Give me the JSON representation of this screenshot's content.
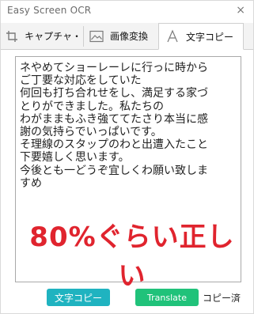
{
  "window": {
    "title": "Easy Screen OCR",
    "close_glyph": "×"
  },
  "tabs": [
    {
      "label": "キャプチャ・",
      "icon": "crop-icon",
      "active": false
    },
    {
      "label": "画像変換",
      "icon": "image-icon",
      "active": false
    },
    {
      "label": "文字コピー",
      "icon": "text-icon",
      "active": true
    }
  ],
  "ocr": {
    "text": "ネやめてショーレーレに行っに時から\nご丁要な対応をしていた\n何回も打ち合れせをし、満足する家づ\nとりができました。私たちの\nわがままもふき強ててたさり本当に感\n謝の気持らでいっぱいです。\nそ理線のスタップのわと出遭入たこと\n下要嬉しく思います。\n今後とも一どうぞ宜しくわ願い致しま\nすめ",
    "overlay_note": "80%ぐらい正しい"
  },
  "footer": {
    "copy_label": "文字コピー",
    "translate_label": "Translate",
    "status_text": "コピー済"
  },
  "colors": {
    "copy_button": "#1fb3c0",
    "translate_button": "#20c27a",
    "overlay_note": "#e0242e"
  }
}
